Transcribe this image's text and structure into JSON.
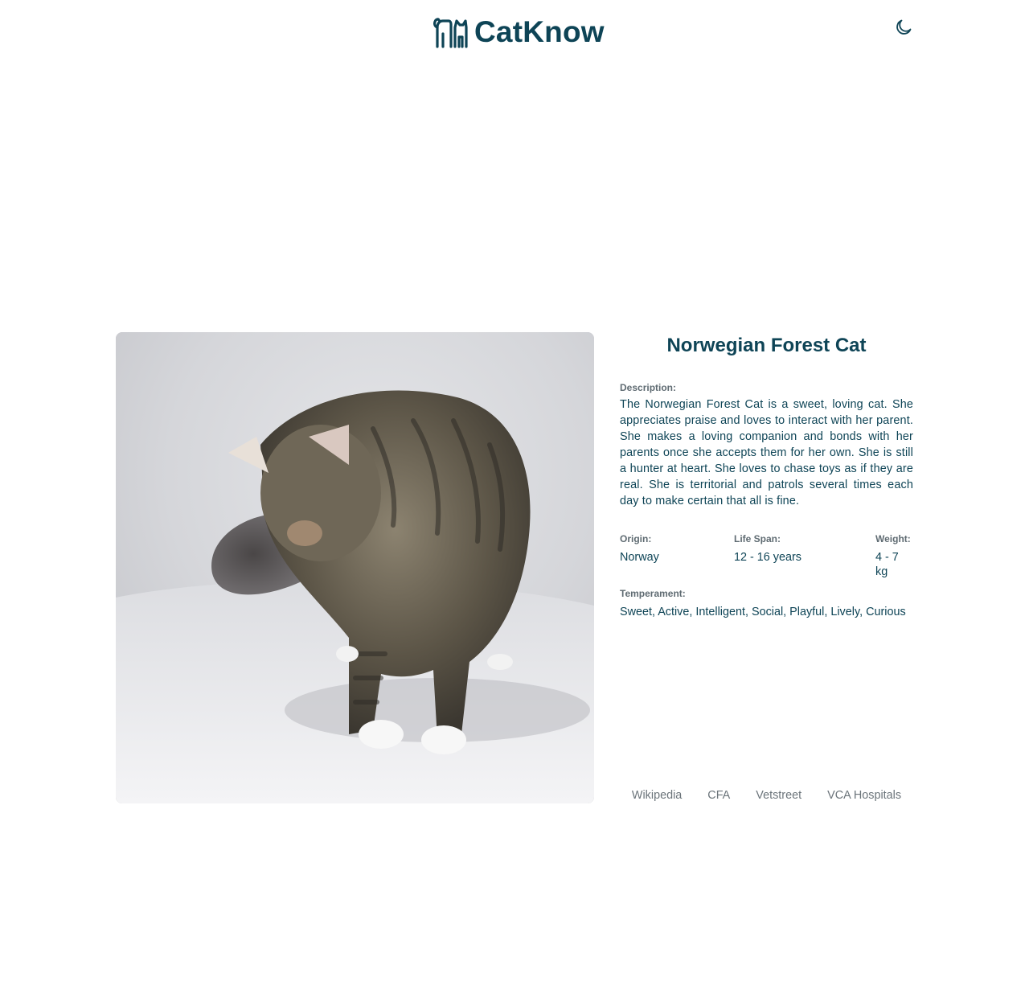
{
  "header": {
    "brand_name": "CatKnow",
    "logo_icon": "cat-family-icon",
    "theme_toggle_icon": "moon-icon"
  },
  "breed": {
    "name": "Norwegian Forest Cat",
    "image_alt": "Norwegian Forest Cat",
    "description_label": "Description:",
    "description": "The Norwegian Forest Cat is a sweet, loving cat. She appreciates praise and loves to interact with her parent. She makes a loving companion and bonds with her parents once she accepts them for her own. She is still a hunter at heart. She loves to chase toys as if they are real. She is territorial and patrols several times each day to make certain that all is fine.",
    "origin_label": "Origin:",
    "origin": "Norway",
    "life_span_label": "Life Span:",
    "life_span": "12 - 16 years",
    "weight_label": "Weight:",
    "weight": "4 - 7 kg",
    "temperament_label": "Temperament:",
    "temperament": "Sweet, Active, Intelligent, Social, Playful, Lively, Curious"
  },
  "links": [
    {
      "label": "Wikipedia"
    },
    {
      "label": "CFA"
    },
    {
      "label": "Vetstreet"
    },
    {
      "label": "VCA Hospitals"
    }
  ],
  "colors": {
    "primary": "#0e4456",
    "label": "#5f6b72",
    "link": "#6b747a",
    "background": "#ffffff"
  }
}
